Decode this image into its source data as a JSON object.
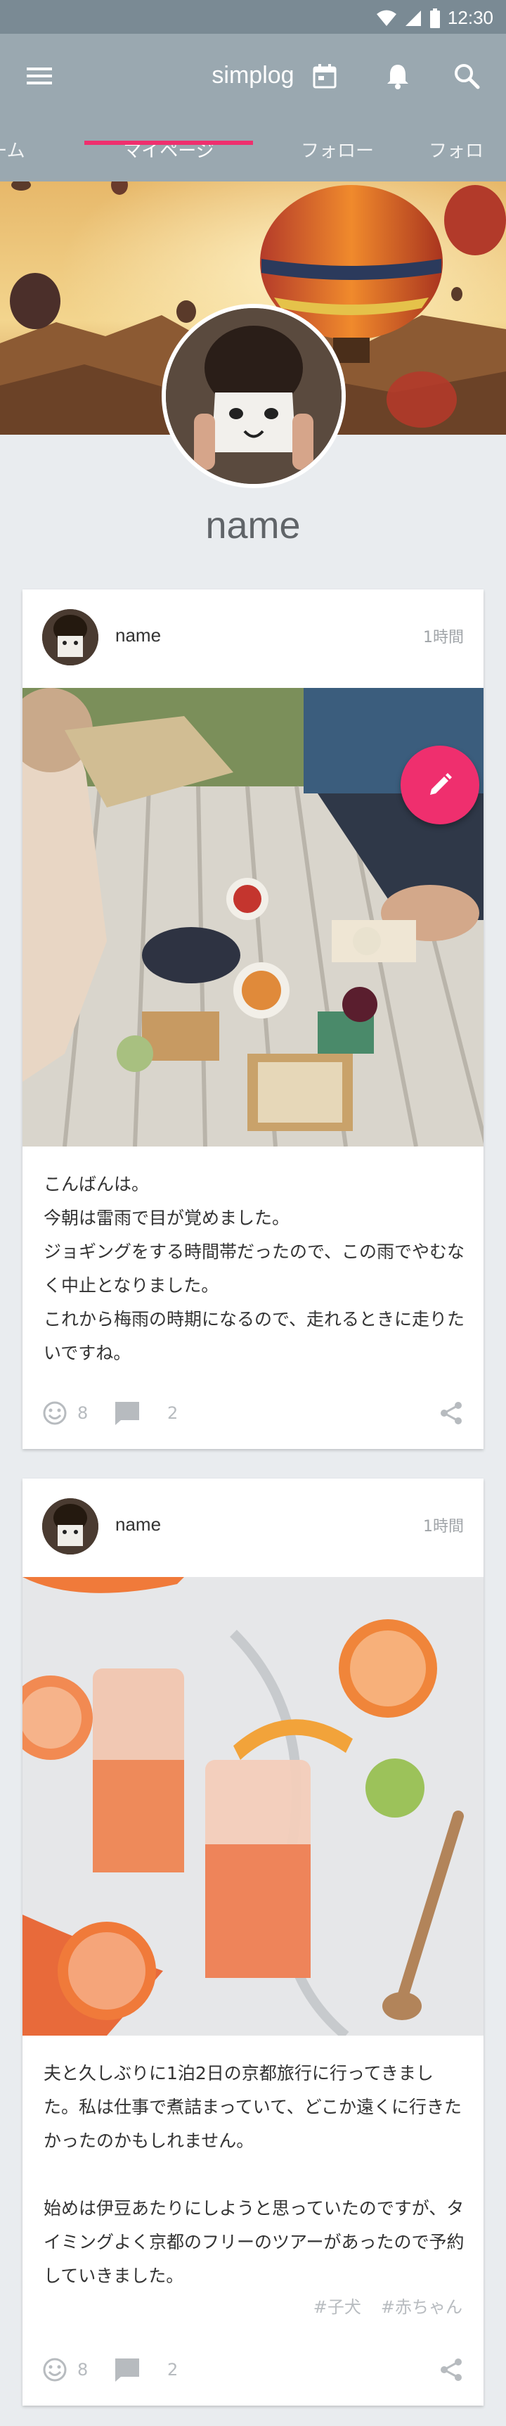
{
  "status_bar": {
    "time": "12:30"
  },
  "app_bar": {
    "title": "simplog"
  },
  "tabs": [
    {
      "label": "ーム"
    },
    {
      "label": "マイページ",
      "active": true
    },
    {
      "label": "フォロー"
    },
    {
      "label": "フォロ"
    }
  ],
  "profile": {
    "name": "name"
  },
  "posts": [
    {
      "author": "name",
      "time": "1時間",
      "text": "こんばんは。\n今朝は雷雨で目が覚めました。\nジョギングをする時間帯だったので、この雨でやむなく中止となりました。\nこれから梅雨の時期になるので、走れるときに走りたいですね。",
      "likes": "8",
      "comments": "2",
      "tags": []
    },
    {
      "author": "name",
      "time": "1時間",
      "text": "夫と久しぶりに1泊2日の京都旅行に行ってきました。私は仕事で煮詰まっていて、どこか遠くに行きたかったのかもしれません。\n\n始めは伊豆あたりにしようと思っていたのですが、タイミングよく京都のフリーのツアーがあったので予約していきました。",
      "likes": "8",
      "comments": "2",
      "tags": [
        "#子犬",
        "#赤ちゃん"
      ]
    }
  ],
  "colors": {
    "accent": "#ef2f6e",
    "app_bar": "#9aa8b0",
    "status_bar": "#7a8a94"
  },
  "icons": [
    "menu-icon",
    "calendar-icon",
    "bell-icon",
    "search-icon",
    "wifi-icon",
    "signal-icon",
    "battery-icon",
    "pencil-icon",
    "smile-icon",
    "comment-icon",
    "share-icon"
  ]
}
